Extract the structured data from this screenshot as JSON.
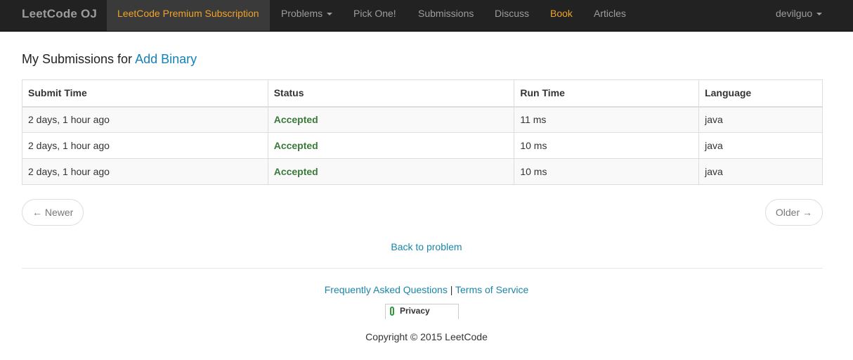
{
  "navbar": {
    "brand": "LeetCode OJ",
    "premium": "LeetCode Premium Subscription",
    "problems": "Problems",
    "pick_one": "Pick One!",
    "submissions": "Submissions",
    "discuss": "Discuss",
    "book": "Book",
    "articles": "Articles",
    "user": "devilguo"
  },
  "heading": {
    "prefix": "My Submissions for ",
    "problem": "Add Binary"
  },
  "table": {
    "headers": [
      "Submit Time",
      "Status",
      "Run Time",
      "Language"
    ],
    "rows": [
      [
        "2 days, 1 hour ago",
        "Accepted",
        "11 ms",
        "java"
      ],
      [
        "2 days, 1 hour ago",
        "Accepted",
        "10 ms",
        "java"
      ],
      [
        "2 days, 1 hour ago",
        "Accepted",
        "10 ms",
        "java"
      ]
    ]
  },
  "pager": {
    "newer": "← Newer",
    "older": "Older →"
  },
  "back_link": "Back to problem",
  "footer": {
    "faq": "Frequently Asked Questions",
    "separator": "|",
    "terms": "Terms of Service",
    "privacy": "Privacy",
    "copyright": "Copyright © 2015 LeetCode"
  },
  "colors": {
    "navbar_bg": "#222222",
    "accent_orange": "#f0a32a",
    "link_blue": "#1482b8",
    "accepted_green": "#3a7a3a"
  }
}
